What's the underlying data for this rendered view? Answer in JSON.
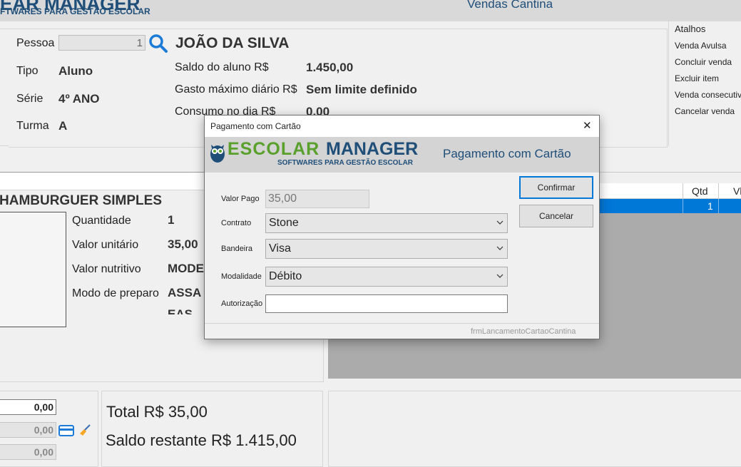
{
  "app": {
    "logo_main": "EAR MANAGER",
    "logo_sub": "FTWARES PARA GESTÃO ESCOLAR",
    "window_title": "Vendas Cantina"
  },
  "person": {
    "pessoa_label": "Pessoa",
    "pessoa_value": "1",
    "name": "JOÃO DA SILVA",
    "tipo_label": "Tipo",
    "tipo_value": "Aluno",
    "serie_label": "Série",
    "serie_value": "4º ANO",
    "turma_label": "Turma",
    "turma_value": "A",
    "saldo_label": "Saldo do aluno R$",
    "saldo_value": "1.450,00",
    "gasto_label": "Gasto máximo diário R$",
    "gasto_value": "Sem limite definido",
    "consumo_label": "Consumo no dia R$",
    "consumo_value": "0,00"
  },
  "shortcuts": {
    "title": "Atalhos",
    "items": [
      "Venda Avulsa",
      "Concluir venda",
      "Excluir item",
      "Venda consecutiv",
      "Cancelar venda"
    ]
  },
  "product": {
    "name": "HAMBURGUER SIMPLES",
    "qty_label": "Quantidade",
    "qty_value": "1",
    "unit_label": "Valor unitário",
    "unit_value": "35,00",
    "nutri_label": "Valor nutritivo",
    "nutri_value": "MODE",
    "prep_label": "Modo de preparo",
    "prep_value": "ASSA",
    "prep_value2": "EAS"
  },
  "grid": {
    "col_qtd": "Qtd",
    "col_vl": "Vl",
    "row_qtd": "1"
  },
  "payments": {
    "field1": "0,00",
    "field2": "0,00",
    "field3": "0,00"
  },
  "totals": {
    "total": "Total R$ 35,00",
    "saldo_restante": "Saldo restante R$ 1.415,00"
  },
  "dialog": {
    "title": "Pagamento com Cartão",
    "logo_main_a": "ESCOLAR",
    "logo_main_b": "MANAGER",
    "logo_sub": "SOFTWARES PARA GESTÃO ESCOLAR",
    "header_title": "Pagamento com Cartão",
    "valor_label": "Valor Pago",
    "valor_value": "35,00",
    "contrato_label": "Contrato",
    "contrato_value": "Stone",
    "bandeira_label": "Bandeira",
    "bandeira_value": "Visa",
    "modalidade_label": "Modalidade",
    "modalidade_value": "Débito",
    "autorizacao_label": "Autorização",
    "autorizacao_value": "",
    "confirm_label": "Confirmar",
    "cancel_label": "Cancelar",
    "form_name": "frmLancamentoCartaoCantina",
    "close_glyph": "✕"
  },
  "colors": {
    "accent_blue": "#0078d7",
    "logo_green": "#5aa02c",
    "logo_navy": "#1f4e79"
  }
}
